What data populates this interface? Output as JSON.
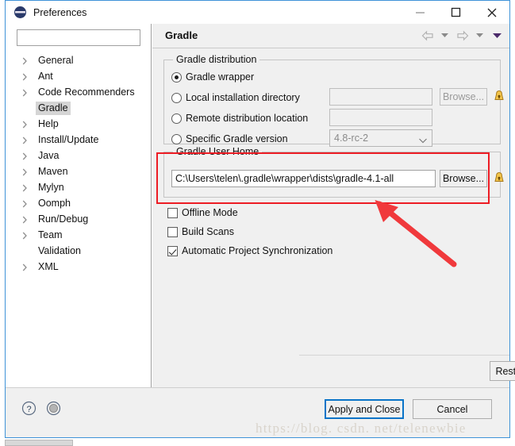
{
  "window": {
    "title": "Preferences",
    "icon": "eclipse-globe-icon",
    "minimize_label": "–",
    "maximize_label": "□",
    "close_label": "✕"
  },
  "sidebar": {
    "filter_value": "",
    "filter_placeholder": "",
    "items": [
      {
        "label": "General",
        "expandable": true,
        "selected": false
      },
      {
        "label": "Ant",
        "expandable": true,
        "selected": false
      },
      {
        "label": "Code Recommenders",
        "expandable": true,
        "selected": false
      },
      {
        "label": "Gradle",
        "expandable": false,
        "selected": true
      },
      {
        "label": "Help",
        "expandable": true,
        "selected": false
      },
      {
        "label": "Install/Update",
        "expandable": true,
        "selected": false
      },
      {
        "label": "Java",
        "expandable": true,
        "selected": false
      },
      {
        "label": "Maven",
        "expandable": true,
        "selected": false
      },
      {
        "label": "Mylyn",
        "expandable": true,
        "selected": false
      },
      {
        "label": "Oomph",
        "expandable": true,
        "selected": false
      },
      {
        "label": "Run/Debug",
        "expandable": true,
        "selected": false
      },
      {
        "label": "Team",
        "expandable": true,
        "selected": false
      },
      {
        "label": "Validation",
        "expandable": false,
        "selected": false
      },
      {
        "label": "XML",
        "expandable": true,
        "selected": false
      }
    ]
  },
  "page": {
    "title": "Gradle",
    "nav": {
      "back": "back-arrow",
      "back_menu": "back-dropdown",
      "forward": "forward-arrow",
      "forward_menu": "forward-dropdown",
      "view_menu": "view-menu-triangle"
    },
    "distribution_group": {
      "label": "Gradle distribution",
      "options": [
        {
          "label": "Gradle wrapper",
          "selected": true
        },
        {
          "label": "Local installation directory",
          "selected": false
        },
        {
          "label": "Remote distribution location",
          "selected": false
        },
        {
          "label": "Specific Gradle version",
          "selected": false
        }
      ],
      "local_dir_value": "",
      "remote_url_value": "",
      "version_value": "4.8-rc-2",
      "browse_label": "Browse...",
      "warning_icon": "warning-lock-icon"
    },
    "user_home_group": {
      "label": "Gradle User Home",
      "path_value": "C:\\Users\\telen\\.gradle\\wrapper\\dists\\gradle-4.1-all",
      "browse_label": "Browse...",
      "warning_icon": "warning-lock-icon"
    },
    "checkboxes": [
      {
        "label": "Offline Mode",
        "checked": false
      },
      {
        "label": "Build Scans",
        "checked": false
      },
      {
        "label": "Automatic Project Synchronization",
        "checked": true
      }
    ],
    "action_buttons": {
      "restore_defaults": "Restore Defaults",
      "restore_defaults_pre": "Restore ",
      "restore_defaults_mnemonic": "D",
      "restore_defaults_post": "efaults",
      "apply_mnemonic": "A",
      "apply_post": "pply"
    }
  },
  "footer": {
    "help_icon": "help-question-icon",
    "restore_icon": "restore-window-icon",
    "apply_and_close": "Apply and Close",
    "cancel": "Cancel"
  },
  "annotation": {
    "box_color": "#ed1c24",
    "arrow_color": "#f0393c",
    "highlighted_area": "Gradle User Home"
  },
  "watermark": {
    "text": "https://blog. csdn. net/telenewbie"
  }
}
